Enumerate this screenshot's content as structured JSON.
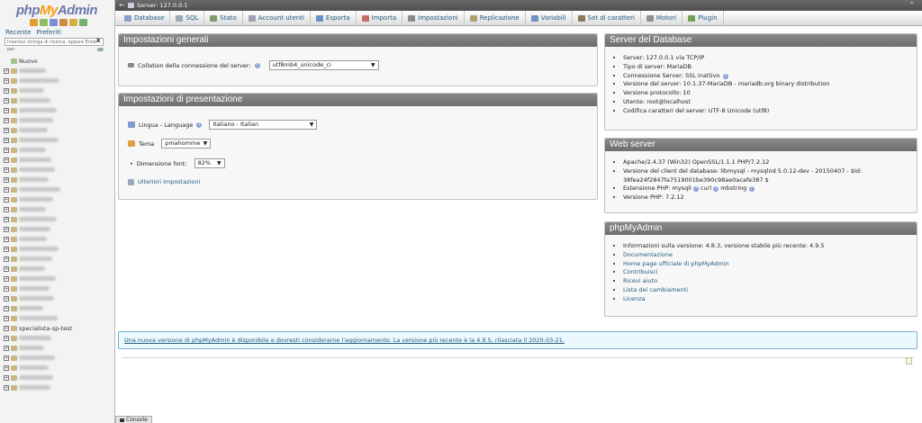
{
  "nav": {
    "logo": {
      "php": "php",
      "my": "My",
      "admin": "Admin"
    },
    "icon_colors": [
      "#e0a030",
      "#8fbf5a",
      "#7b8fd0",
      "#d08a48",
      "#d5b040",
      "#76b070"
    ],
    "link_recent": "Recente",
    "link_favorites": "Preferiti",
    "filter_placeholder": "Inserisci stringa di ricerca, oppure Enter per",
    "filter_clear": "X",
    "tree": [
      {
        "expander": "",
        "label": "Nuovo",
        "blur": false
      },
      {
        "expander": "+",
        "label": "",
        "blur": true
      },
      {
        "expander": "+",
        "label": "",
        "blur": true
      },
      {
        "expander": "+",
        "label": "",
        "blur": true
      },
      {
        "expander": "+",
        "label": "",
        "blur": true
      },
      {
        "expander": "+",
        "label": "",
        "blur": true
      },
      {
        "expander": "+",
        "label": "",
        "blur": true
      },
      {
        "expander": "+",
        "label": "",
        "blur": true
      },
      {
        "expander": "+",
        "label": "",
        "blur": true
      },
      {
        "expander": "+",
        "label": "",
        "blur": true
      },
      {
        "expander": "+",
        "label": "",
        "blur": true
      },
      {
        "expander": "+",
        "label": "",
        "blur": true
      },
      {
        "expander": "+",
        "label": "",
        "blur": true
      },
      {
        "expander": "+",
        "label": "",
        "blur": true
      },
      {
        "expander": "+",
        "label": "",
        "blur": true
      },
      {
        "expander": "+",
        "label": "",
        "blur": true
      },
      {
        "expander": "+",
        "label": "",
        "blur": true
      },
      {
        "expander": "+",
        "label": "",
        "blur": true
      },
      {
        "expander": "+",
        "label": "",
        "blur": true
      },
      {
        "expander": "+",
        "label": "",
        "blur": true
      },
      {
        "expander": "+",
        "label": "",
        "blur": true
      },
      {
        "expander": "+",
        "label": "",
        "blur": true
      },
      {
        "expander": "+",
        "label": "",
        "blur": true
      },
      {
        "expander": "+",
        "label": "",
        "blur": true
      },
      {
        "expander": "+",
        "label": "",
        "blur": true
      },
      {
        "expander": "+",
        "label": "",
        "blur": true
      },
      {
        "expander": "+",
        "label": "",
        "blur": true
      },
      {
        "expander": "+",
        "label": "specialista-sp-test",
        "blur": false
      },
      {
        "expander": "+",
        "label": "",
        "blur": true
      },
      {
        "expander": "+",
        "label": "",
        "blur": true
      },
      {
        "expander": "+",
        "label": "",
        "blur": true
      },
      {
        "expander": "+",
        "label": "",
        "blur": true
      },
      {
        "expander": "+",
        "label": "",
        "blur": true
      },
      {
        "expander": "+",
        "label": "",
        "blur": true
      }
    ]
  },
  "serverbar": {
    "back": "←",
    "title": "Server: 127.0.0.1",
    "collapse": "⌃"
  },
  "tabs": [
    {
      "label": "Database",
      "color": "#8aa0c8"
    },
    {
      "label": "SQL",
      "color": "#9aa8b8"
    },
    {
      "label": "Stato",
      "color": "#7c9b6e"
    },
    {
      "label": "Account utenti",
      "color": "#a0a0b8"
    },
    {
      "label": "Esporta",
      "color": "#6b8fc8"
    },
    {
      "label": "Importa",
      "color": "#c86b6b"
    },
    {
      "label": "Impostazioni",
      "color": "#8a8a8a"
    },
    {
      "label": "Replicazione",
      "color": "#b0a070"
    },
    {
      "label": "Variabili",
      "color": "#7090c0"
    },
    {
      "label": "Set di caratteri",
      "color": "#8a7a5a"
    },
    {
      "label": "Motori",
      "color": "#909090"
    },
    {
      "label": "Plugin",
      "color": "#70a050"
    }
  ],
  "general": {
    "title": "Impostazioni generali",
    "collation_label": "Collation della connessione del server:",
    "collation_value": "utf8mb4_unicode_ci",
    "help": "?"
  },
  "presentation": {
    "title": "Impostazioni di presentazione",
    "language_label": "Lingua - Language",
    "language_value": "Italiano - Italian",
    "theme_label": "Tema",
    "theme_value": "pmahomme",
    "font_label": "Dimensione font:",
    "font_value": "82%",
    "more_settings": "Ulteriori impostazioni"
  },
  "db_server": {
    "title": "Server del Database",
    "items": [
      "Server: 127.0.0.1 via TCP/IP",
      "Tipo di server: MariaDB",
      "Connessione Server: SSL inattivo",
      "Versione del server: 10.1.37-MariaDB - mariadb.org binary distribution",
      "Versione protocollo: 10",
      "Utente: root@localhost",
      "Codifica caratteri del server: UTF-8 Unicode (utf8)"
    ]
  },
  "web_server": {
    "title": "Web server",
    "item1": "Apache/2.4.37 (Win32) OpenSSL/1.1.1 PHP/7.2.12",
    "item2a": "Versione del client del database: libmysql - mysqlnd 5.0.12-dev - 20150407 - $Id:",
    "item2b": "38fea24f2847fa7519001be390c98ae0acafe387 $",
    "item3_prefix": "Estensione PHP: mysqli",
    "item3_curl": "curl",
    "item3_mb": "mbstring",
    "item4": "Versione PHP: 7.2.12"
  },
  "pma": {
    "title": "phpMyAdmin",
    "version_info": "Informazioni sulla versione: 4.8.3, versione stabile più recente: 4.9.5",
    "links": [
      "Documentazione",
      "Home page ufficiale di phpMyAdmin",
      "Contribuisci",
      "Ricevi aiuto",
      "Lista dei cambiamenti",
      "Licenza"
    ]
  },
  "notice": "Una nuova versione di phpMyAdmin è disponibile e dovresti considerarne l'aggiornamento. La versione più recente è la 4.9.5, rilasciata il 2020-03-21.",
  "console": "Console"
}
